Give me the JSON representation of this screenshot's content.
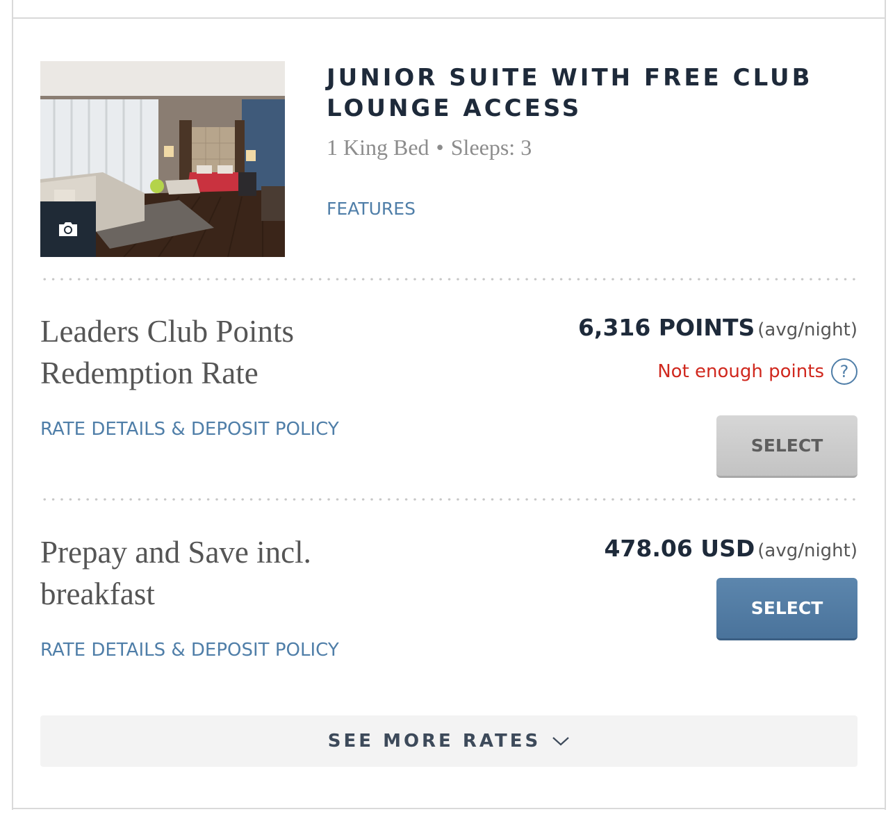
{
  "room": {
    "title": "JUNIOR SUITE WITH FREE CLUB LOUNGE ACCESS",
    "bed": "1 King Bed",
    "separator": "•",
    "sleeps": "Sleeps: 3",
    "features_label": "FEATURES",
    "photo_icon": "camera-icon"
  },
  "rates": [
    {
      "name": "Leaders Club Points Redemption Rate",
      "price": "6,316 POINTS",
      "per": "(avg/night)",
      "warning": "Not enough points",
      "help_icon": "question-icon",
      "help_glyph": "?",
      "details_label": "RATE DETAILS & DEPOSIT POLICY",
      "select_label": "SELECT",
      "select_enabled": false
    },
    {
      "name": "Prepay and Save incl. breakfast",
      "price": "478.06 USD",
      "per": "(avg/night)",
      "details_label": "RATE DETAILS & DEPOSIT POLICY",
      "select_label": "SELECT",
      "select_enabled": true
    }
  ],
  "more_rates": {
    "label": "SEE MORE RATES",
    "icon": "chevron-down-icon"
  },
  "colors": {
    "link": "#4f7ea8",
    "title": "#1e2a3a",
    "warning": "#d0281e",
    "primary_button": "#4f7ea8",
    "disabled_button": "#cccccc"
  }
}
